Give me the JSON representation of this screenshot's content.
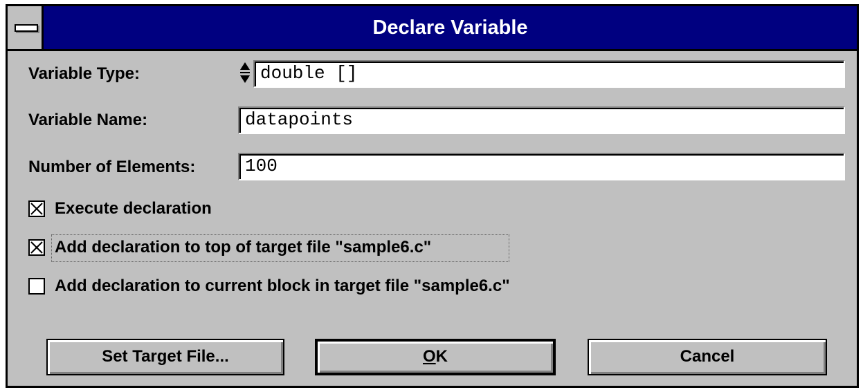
{
  "window": {
    "title": "Declare Variable"
  },
  "fields": {
    "variable_type": {
      "label": "Variable Type:",
      "value": "double []"
    },
    "variable_name": {
      "label": "Variable Name:",
      "value": "datapoints"
    },
    "number_of_elements": {
      "label": "Number of Elements:",
      "value": "100"
    }
  },
  "options": {
    "execute": {
      "label": "Execute declaration",
      "checked": true
    },
    "add_top": {
      "label": "Add declaration to top of target file \"sample6.c\"",
      "checked": true
    },
    "add_block": {
      "label": "Add declaration to current block in target file \"sample6.c\"",
      "checked": false
    }
  },
  "buttons": {
    "set_target": "Set Target File...",
    "ok_mnemonic": "O",
    "ok_rest": "K",
    "cancel": "Cancel"
  },
  "colors": {
    "titlebar": "#000080",
    "face": "#c0c0c0"
  }
}
